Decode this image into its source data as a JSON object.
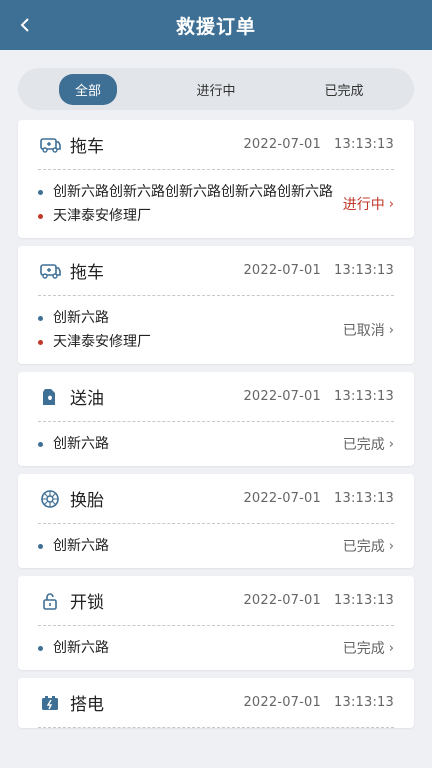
{
  "header": {
    "title": "救援订单",
    "back_icon": "chevron-left-icon"
  },
  "tabs": [
    {
      "label": "全部",
      "active": true
    },
    {
      "label": "进行中",
      "active": false
    },
    {
      "label": "已完成",
      "active": false
    }
  ],
  "orders": [
    {
      "icon": "tow-truck-icon",
      "type": "拖车",
      "date": "2022-07-01",
      "time": "13:13:13",
      "from": "创新六路创新六路创新六路创新六路创新六路",
      "to": "天津泰安修理厂",
      "status": "进行中",
      "status_color": "#c0392b"
    },
    {
      "icon": "tow-truck-icon",
      "type": "拖车",
      "date": "2022-07-01",
      "time": "13:13:13",
      "from": "创新六路",
      "to": "天津泰安修理厂",
      "status": "已取消",
      "status_color": "#666666"
    },
    {
      "icon": "fuel-icon",
      "type": "送油",
      "date": "2022-07-01",
      "time": "13:13:13",
      "from": "创新六路",
      "status": "已完成",
      "status_color": "#666666"
    },
    {
      "icon": "tire-icon",
      "type": "换胎",
      "date": "2022-07-01",
      "time": "13:13:13",
      "from": "创新六路",
      "status": "已完成",
      "status_color": "#666666"
    },
    {
      "icon": "unlock-icon",
      "type": "开锁",
      "date": "2022-07-01",
      "time": "13:13:13",
      "from": "创新六路",
      "status": "已完成",
      "status_color": "#666666"
    },
    {
      "icon": "battery-icon",
      "type": "搭电",
      "date": "2022-07-01",
      "time": "13:13:13"
    }
  ],
  "colors": {
    "primary": "#3e6f95",
    "accent_red": "#c0392b",
    "background": "#eef0f4"
  }
}
